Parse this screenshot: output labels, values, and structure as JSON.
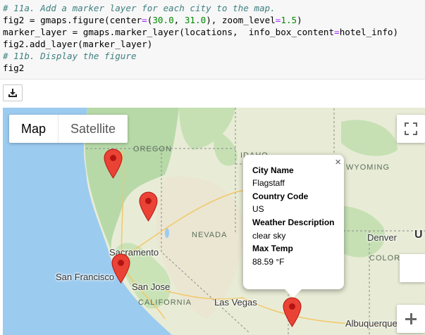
{
  "code": {
    "line1_comment": "# 11a. Add a marker layer for each city to the map.",
    "line2_a": "fig2 = gmaps.figure(center",
    "line2_eq": "=",
    "line2_b": "(",
    "line2_n1": "30.0",
    "line2_c": ", ",
    "line2_n2": "31.0",
    "line2_d": "), zoom_level",
    "line2_eq2": "=",
    "line2_n3": "1.5",
    "line2_e": ")",
    "line3_a": "marker_layer = gmaps.marker_layer(locations,  info_box_content",
    "line3_eq": "=",
    "line3_b": "hotel_info)",
    "line4": "fig2.add_layer(marker_layer)",
    "line5_comment": "# 11b. Display the figure",
    "line6": "fig2"
  },
  "toolbar": {
    "download_icon": "download-icon"
  },
  "map": {
    "type_buttons": {
      "map": "Map",
      "satellite": "Satellite"
    },
    "region_labels": {
      "oregon": "OREGON",
      "idaho": "IDAHO",
      "wyoming": "WYOMING",
      "nevada": "NEVADA",
      "california": "CALIFORNIA",
      "colorado": "COLOR"
    },
    "cities": {
      "sacramento": "Sacramento",
      "san_francisco": "San Francisco",
      "san_jose": "San Jose",
      "las_vegas": "Las Vegas",
      "denver": "Denver",
      "albuquerque": "Albuquerque",
      "u_partial": "U"
    },
    "info_box": {
      "close": "×",
      "city_name_label": "City Name",
      "city_name": "Flagstaff",
      "country_code_label": "Country Code",
      "country_code": "US",
      "weather_label": "Weather Description",
      "weather": "clear sky",
      "max_temp_label": "Max Temp",
      "max_temp": "88.59 °F"
    },
    "zoom_in": "+",
    "colors": {
      "pin": "#ea4335",
      "pin_dark": "#b31412",
      "water": "#9ccbf0",
      "land": "#e8ecd6",
      "forest": "#b7d9a8"
    }
  }
}
